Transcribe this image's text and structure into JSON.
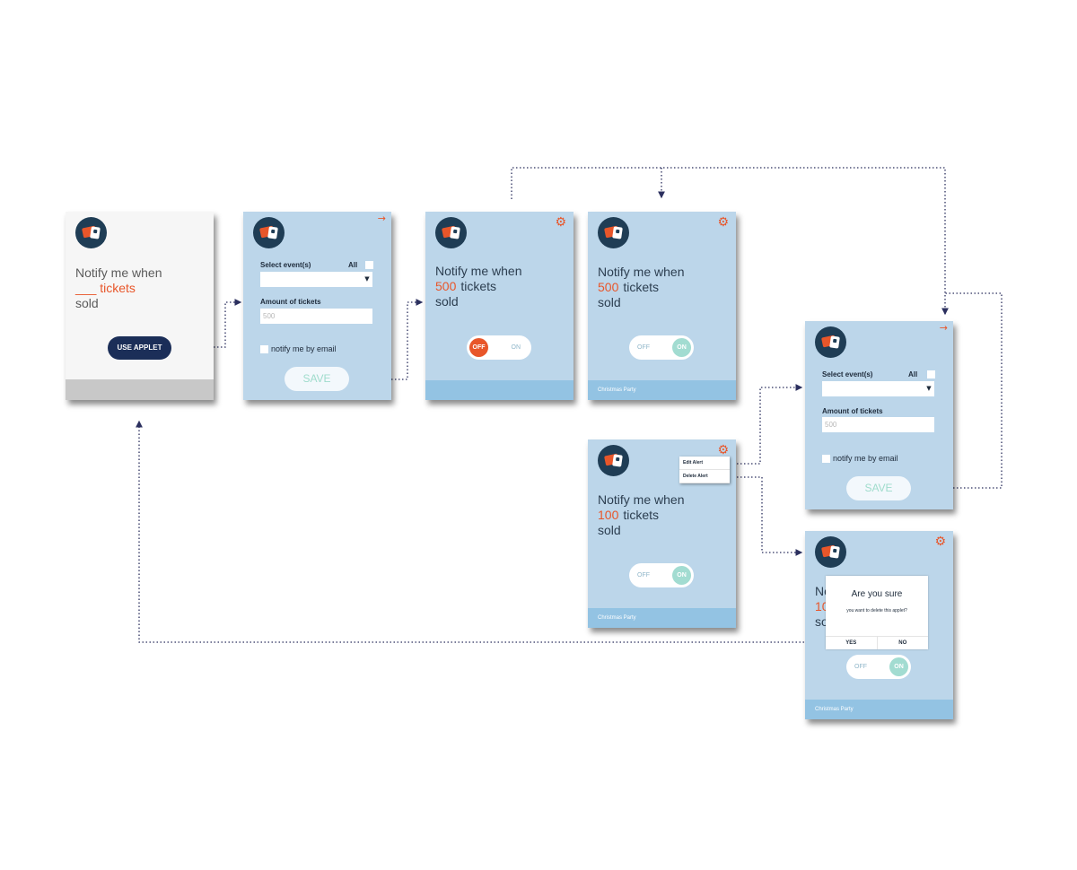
{
  "intro_card": {
    "line1": "Notify me when",
    "blank": "___",
    "tickets": "tickets",
    "line3": "sold",
    "button": "USE APPLET"
  },
  "form_card": {
    "select_label": "Select event(s)",
    "all_label": "All",
    "amount_label": "Amount of tickets",
    "amount_placeholder": "500",
    "email_label": "notify me by email",
    "save": "SAVE"
  },
  "alert_card_500_off": {
    "line1": "Notify me when",
    "number": "500",
    "tickets": "tickets",
    "line3": "sold",
    "toggle_off": "OFF",
    "toggle_on": "ON"
  },
  "alert_card_500_on": {
    "line1": "Notify me when",
    "number": "500",
    "tickets": "tickets",
    "line3": "sold",
    "toggle_off": "OFF",
    "toggle_on": "ON",
    "footer": "Christmas Party"
  },
  "alert_card_100": {
    "line1": "Notify me when",
    "number": "100",
    "tickets": "tickets",
    "line3": "sold",
    "toggle_off": "OFF",
    "toggle_on": "ON",
    "footer": "Christmas Party",
    "menu": [
      "Edit Alert",
      "Delete Alert"
    ]
  },
  "edit_form_card": {
    "select_label": "Select event(s)",
    "all_label": "All",
    "amount_label": "Amount of tickets",
    "amount_placeholder": "500",
    "email_label": "notify me by email",
    "save": "SAVE"
  },
  "delete_card": {
    "partial_line1": "No",
    "partial_number": "10",
    "partial_line3": "so",
    "dialog_title": "Are you sure",
    "dialog_message": "you want to delete this applet?",
    "yes": "YES",
    "no": "NO",
    "toggle_off": "OFF",
    "toggle_on": "ON",
    "footer": "Christmas Party"
  },
  "colors": {
    "card_blue": "#bcd6ea",
    "accent_orange": "#e8562a",
    "navy": "#1b2e58",
    "connector": "#2b2f5e"
  },
  "icons": [
    "ticket-logo-icon",
    "gear-icon",
    "arrow-right-icon",
    "chevron-down-icon"
  ]
}
